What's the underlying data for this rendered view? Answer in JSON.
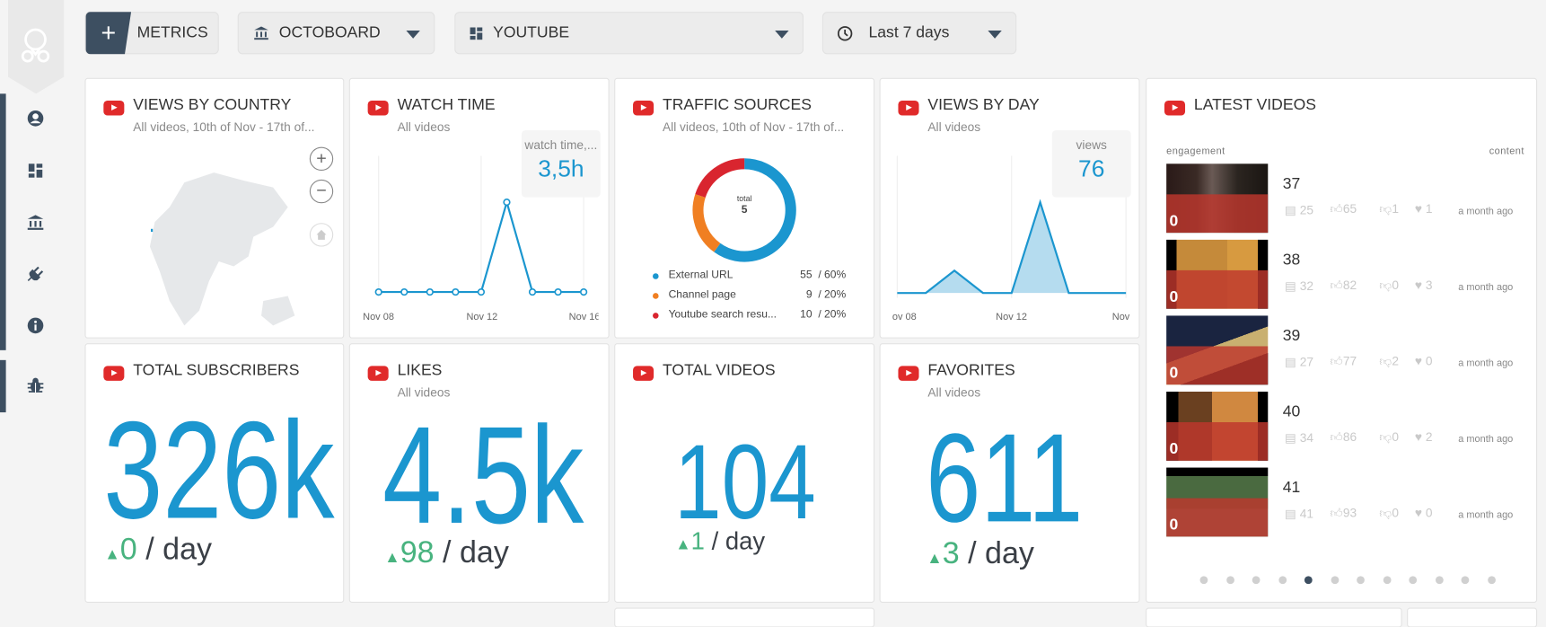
{
  "topbar": {
    "metrics_label": "METRICS",
    "plus": "+",
    "org_label": "OCTOBOARD",
    "board_label": "YOUTUBE",
    "range_label": "Last 7 days"
  },
  "sidebar": {
    "items": [
      {
        "icon": "user-circle-icon"
      },
      {
        "icon": "dashboard-icon"
      },
      {
        "icon": "bank-icon"
      },
      {
        "icon": "plug-icon"
      },
      {
        "icon": "info-icon"
      },
      {
        "icon": "bug-icon"
      }
    ]
  },
  "colors": {
    "accent": "#1b96cf",
    "youtube_red": "#e02a2a",
    "positive": "#48b37f",
    "sidebar_dark": "#3d4f61"
  },
  "cards": {
    "views_by_country": {
      "title": "VIEWS BY COUNTRY",
      "subtitle": "All videos, 10th of Nov - 17th of...",
      "zoom_in": "+",
      "zoom_out": "−"
    },
    "watch_time": {
      "title": "WATCH TIME",
      "subtitle": "All videos",
      "kpi_label": "watch time,...",
      "kpi_value": "3,5h"
    },
    "traffic_sources": {
      "title": "TRAFFIC SOURCES",
      "subtitle": "All videos, 10th of Nov - 17th of...",
      "total_label": "total",
      "total_value": "5"
    },
    "views_by_day": {
      "title": "VIEWS BY DAY",
      "subtitle": "All videos",
      "kpi_label": "views",
      "kpi_value": "76"
    },
    "total_subscribers": {
      "title": "TOTAL SUBSCRIBERS",
      "value": "326k",
      "delta": "0",
      "per": "/ day"
    },
    "likes": {
      "title": "LIKES",
      "subtitle": "All videos",
      "value": "4.5k",
      "delta": "98",
      "per": "/ day"
    },
    "total_videos": {
      "title": "TOTAL VIDEOS",
      "value": "104",
      "delta": "1",
      "per": "/ day"
    },
    "favorites": {
      "title": "FAVORITES",
      "subtitle": "All videos",
      "value": "611",
      "delta": "3",
      "per": "/ day"
    },
    "latest_videos": {
      "title": "LATEST VIDEOS",
      "col_left": "engagement",
      "col_right": "content",
      "page_count": 12,
      "active_page": 5,
      "videos": [
        {
          "title": "37",
          "engagement": "0",
          "comments": "25",
          "likes": "65",
          "dislikes": "1",
          "favorites": "1",
          "age": "a month ago"
        },
        {
          "title": "38",
          "engagement": "0",
          "comments": "32",
          "likes": "82",
          "dislikes": "0",
          "favorites": "3",
          "age": "a month ago"
        },
        {
          "title": "39",
          "engagement": "0",
          "comments": "27",
          "likes": "77",
          "dislikes": "2",
          "favorites": "0",
          "age": "a month ago"
        },
        {
          "title": "40",
          "engagement": "0",
          "comments": "34",
          "likes": "86",
          "dislikes": "0",
          "favorites": "2",
          "age": "a month ago"
        },
        {
          "title": "41",
          "engagement": "0",
          "comments": "41",
          "likes": "93",
          "dislikes": "0",
          "favorites": "0",
          "age": "a month ago"
        }
      ]
    }
  },
  "chart_data": [
    {
      "type": "line",
      "x": [
        "Nov 08",
        "Nov 09",
        "Nov 10",
        "Nov 11",
        "Nov 12",
        "Nov 13",
        "Nov 14",
        "Nov 15",
        "Nov 16"
      ],
      "values": [
        0,
        0,
        0,
        0,
        0,
        3.5,
        0,
        0,
        0
      ],
      "tick_labels": [
        "Nov 08",
        "Nov 12",
        "Nov 16"
      ],
      "grid": true
    },
    {
      "type": "pie",
      "donut": true,
      "slices": [
        {
          "label": "External URL",
          "value": "55",
          "percent": "60%",
          "pct": 60,
          "color": "#1b96cf"
        },
        {
          "label": "Channel page",
          "value": "9",
          "percent": "20%",
          "pct": 20,
          "color": "#f07f22"
        },
        {
          "label": "Youtube search resu...",
          "value": "10",
          "percent": "20%",
          "pct": 20,
          "color": "#d9252f"
        }
      ]
    },
    {
      "type": "area",
      "x": [
        "Nov 08",
        "Nov 09",
        "Nov 10",
        "Nov 11",
        "Nov 12",
        "Nov 13",
        "Nov 14",
        "Nov 15",
        "Nov 16"
      ],
      "values": [
        0,
        0,
        15,
        0,
        0,
        61,
        0,
        0,
        0
      ],
      "tick_labels": [
        "ov 08",
        "Nov 12",
        "Nov"
      ],
      "grid": true
    }
  ]
}
